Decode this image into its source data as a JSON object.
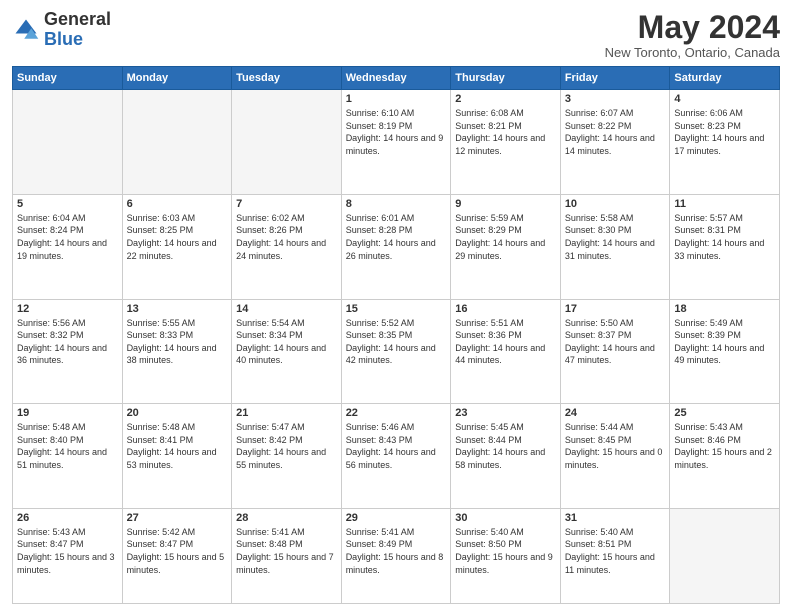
{
  "logo": {
    "general": "General",
    "blue": "Blue"
  },
  "title": {
    "month_year": "May 2024",
    "location": "New Toronto, Ontario, Canada"
  },
  "days_of_week": [
    "Sunday",
    "Monday",
    "Tuesday",
    "Wednesday",
    "Thursday",
    "Friday",
    "Saturday"
  ],
  "weeks": [
    [
      {
        "day": "",
        "info": ""
      },
      {
        "day": "",
        "info": ""
      },
      {
        "day": "",
        "info": ""
      },
      {
        "day": "1",
        "info": "Sunrise: 6:10 AM\nSunset: 8:19 PM\nDaylight: 14 hours\nand 9 minutes."
      },
      {
        "day": "2",
        "info": "Sunrise: 6:08 AM\nSunset: 8:21 PM\nDaylight: 14 hours\nand 12 minutes."
      },
      {
        "day": "3",
        "info": "Sunrise: 6:07 AM\nSunset: 8:22 PM\nDaylight: 14 hours\nand 14 minutes."
      },
      {
        "day": "4",
        "info": "Sunrise: 6:06 AM\nSunset: 8:23 PM\nDaylight: 14 hours\nand 17 minutes."
      }
    ],
    [
      {
        "day": "5",
        "info": "Sunrise: 6:04 AM\nSunset: 8:24 PM\nDaylight: 14 hours\nand 19 minutes."
      },
      {
        "day": "6",
        "info": "Sunrise: 6:03 AM\nSunset: 8:25 PM\nDaylight: 14 hours\nand 22 minutes."
      },
      {
        "day": "7",
        "info": "Sunrise: 6:02 AM\nSunset: 8:26 PM\nDaylight: 14 hours\nand 24 minutes."
      },
      {
        "day": "8",
        "info": "Sunrise: 6:01 AM\nSunset: 8:28 PM\nDaylight: 14 hours\nand 26 minutes."
      },
      {
        "day": "9",
        "info": "Sunrise: 5:59 AM\nSunset: 8:29 PM\nDaylight: 14 hours\nand 29 minutes."
      },
      {
        "day": "10",
        "info": "Sunrise: 5:58 AM\nSunset: 8:30 PM\nDaylight: 14 hours\nand 31 minutes."
      },
      {
        "day": "11",
        "info": "Sunrise: 5:57 AM\nSunset: 8:31 PM\nDaylight: 14 hours\nand 33 minutes."
      }
    ],
    [
      {
        "day": "12",
        "info": "Sunrise: 5:56 AM\nSunset: 8:32 PM\nDaylight: 14 hours\nand 36 minutes."
      },
      {
        "day": "13",
        "info": "Sunrise: 5:55 AM\nSunset: 8:33 PM\nDaylight: 14 hours\nand 38 minutes."
      },
      {
        "day": "14",
        "info": "Sunrise: 5:54 AM\nSunset: 8:34 PM\nDaylight: 14 hours\nand 40 minutes."
      },
      {
        "day": "15",
        "info": "Sunrise: 5:52 AM\nSunset: 8:35 PM\nDaylight: 14 hours\nand 42 minutes."
      },
      {
        "day": "16",
        "info": "Sunrise: 5:51 AM\nSunset: 8:36 PM\nDaylight: 14 hours\nand 44 minutes."
      },
      {
        "day": "17",
        "info": "Sunrise: 5:50 AM\nSunset: 8:37 PM\nDaylight: 14 hours\nand 47 minutes."
      },
      {
        "day": "18",
        "info": "Sunrise: 5:49 AM\nSunset: 8:39 PM\nDaylight: 14 hours\nand 49 minutes."
      }
    ],
    [
      {
        "day": "19",
        "info": "Sunrise: 5:48 AM\nSunset: 8:40 PM\nDaylight: 14 hours\nand 51 minutes."
      },
      {
        "day": "20",
        "info": "Sunrise: 5:48 AM\nSunset: 8:41 PM\nDaylight: 14 hours\nand 53 minutes."
      },
      {
        "day": "21",
        "info": "Sunrise: 5:47 AM\nSunset: 8:42 PM\nDaylight: 14 hours\nand 55 minutes."
      },
      {
        "day": "22",
        "info": "Sunrise: 5:46 AM\nSunset: 8:43 PM\nDaylight: 14 hours\nand 56 minutes."
      },
      {
        "day": "23",
        "info": "Sunrise: 5:45 AM\nSunset: 8:44 PM\nDaylight: 14 hours\nand 58 minutes."
      },
      {
        "day": "24",
        "info": "Sunrise: 5:44 AM\nSunset: 8:45 PM\nDaylight: 15 hours\nand 0 minutes."
      },
      {
        "day": "25",
        "info": "Sunrise: 5:43 AM\nSunset: 8:46 PM\nDaylight: 15 hours\nand 2 minutes."
      }
    ],
    [
      {
        "day": "26",
        "info": "Sunrise: 5:43 AM\nSunset: 8:47 PM\nDaylight: 15 hours\nand 3 minutes."
      },
      {
        "day": "27",
        "info": "Sunrise: 5:42 AM\nSunset: 8:47 PM\nDaylight: 15 hours\nand 5 minutes."
      },
      {
        "day": "28",
        "info": "Sunrise: 5:41 AM\nSunset: 8:48 PM\nDaylight: 15 hours\nand 7 minutes."
      },
      {
        "day": "29",
        "info": "Sunrise: 5:41 AM\nSunset: 8:49 PM\nDaylight: 15 hours\nand 8 minutes."
      },
      {
        "day": "30",
        "info": "Sunrise: 5:40 AM\nSunset: 8:50 PM\nDaylight: 15 hours\nand 9 minutes."
      },
      {
        "day": "31",
        "info": "Sunrise: 5:40 AM\nSunset: 8:51 PM\nDaylight: 15 hours\nand 11 minutes."
      },
      {
        "day": "",
        "info": ""
      }
    ]
  ]
}
